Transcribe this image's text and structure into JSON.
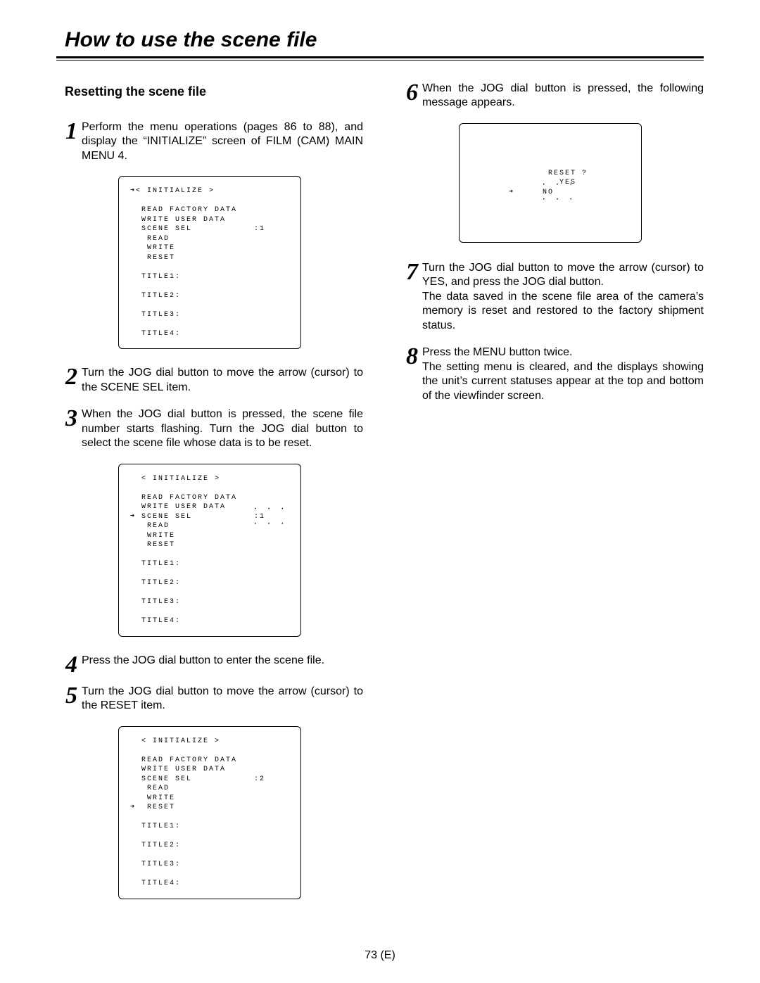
{
  "title": "How to use the scene file",
  "subhead": "Resetting the scene file",
  "steps_left": [
    {
      "num": "1",
      "text": "Perform the menu operations (pages 86 to 88), and display the “INITIALIZE” screen of FILM (CAM) MAIN MENU 4."
    },
    {
      "num": "2",
      "text": "Turn the JOG dial button to move the arrow (cursor) to the SCENE SEL item."
    },
    {
      "num": "3",
      "text": "When the JOG dial button is pressed, the scene file number starts flashing.  Turn the JOG dial button to select the scene file whose data is to be reset."
    },
    {
      "num": "4",
      "text": "Press the JOG dial button to enter the scene file."
    },
    {
      "num": "5",
      "text": "Turn the JOG dial button to move the arrow (cursor) to the RESET item."
    }
  ],
  "steps_right": [
    {
      "num": "6",
      "text": "When the JOG dial button is pressed, the following message appears."
    },
    {
      "num": "7",
      "text": "Turn the JOG dial button to move the arrow (cursor) to YES, and press the JOG dial button.\nThe data saved in the scene file area of the camera’s memory is reset and restored to the factory shipment status."
    },
    {
      "num": "8",
      "text": "Press the MENU button twice.\nThe setting menu is cleared, and the displays showing the unit’s current statuses appear at the top and bottom of the viewfinder screen."
    }
  ],
  "screen1": {
    "header": "< INITIALIZE >",
    "lines": [
      "READ FACTORY DATA",
      "WRITE USER DATA",
      "SCENE SEL           :1",
      " READ",
      " WRITE",
      " RESET",
      "",
      "TITLE1:",
      "",
      "TITLE2:",
      "",
      "TITLE3:",
      "",
      "TITLE4:"
    ],
    "arrow_at_header": true
  },
  "screen2": {
    "header": "< INITIALIZE >",
    "lines_before_flash": [
      "READ FACTORY DATA",
      "WRITE USER DATA"
    ],
    "arrow_line_prefix": "SCENE SEL           ",
    "flash_value": ":1",
    "lines_after_flash": [
      " READ",
      " WRITE",
      " RESET",
      "",
      "TITLE1:",
      "",
      "TITLE2:",
      "",
      "TITLE3:",
      "",
      "TITLE4:"
    ]
  },
  "screen3": {
    "header": "< INITIALIZE >",
    "lines_before_arrow": [
      "READ FACTORY DATA",
      "WRITE USER DATA",
      "SCENE SEL           :2",
      " READ",
      " WRITE"
    ],
    "arrow_line": " RESET",
    "lines_after_arrow": [
      "",
      "TITLE1:",
      "",
      "TITLE2:",
      "",
      "TITLE3:",
      "",
      "TITLE4:"
    ]
  },
  "screen_reset": {
    "question": "RESET ?",
    "option1": "YES",
    "option2_flash": "NO"
  },
  "footer": "73 (E)"
}
